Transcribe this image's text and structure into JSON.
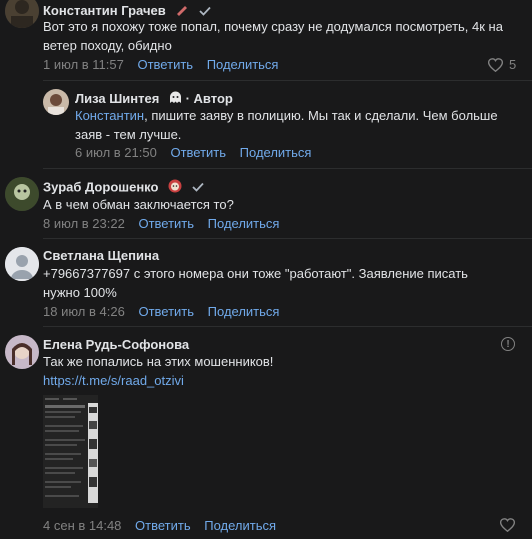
{
  "comments": [
    {
      "author": "Константин Грачев",
      "text": "Вот это я похожу тоже попал, почему сразу не додумался посмотреть, 4к на ветер походу, обидно",
      "date": "1 июл в 11:57",
      "reply_label": "Ответить",
      "share_label": "Поделиться",
      "likes": "5"
    },
    {
      "author": "Лиза Шинтея",
      "author_tag": "· Автор",
      "mention": "Константин",
      "text": ", пишите заяву в полицию. Мы так и сделали. Чем больше заяв - тем лучше.",
      "date": "6 июл в 21:50",
      "reply_label": "Ответить",
      "share_label": "Поделиться"
    },
    {
      "author": "Зураб Дорошенко",
      "text": "А в чем обман заключается то?",
      "date": "8 июл в 23:22",
      "reply_label": "Ответить",
      "share_label": "Поделиться"
    },
    {
      "author": "Светлана Щепина",
      "text": "+79667377697 с этого номера они тоже \"работают\". Заявление писать нужно 100%",
      "date": "18 июл в 4:26",
      "reply_label": "Ответить",
      "share_label": "Поделиться"
    },
    {
      "author": "Елена Рудь-Софонова",
      "text": "Так же попались на этих мошенников!",
      "link": "https://t.me/s/raad_otzivi",
      "date": "4 сен в 14:48",
      "reply_label": "Ответить",
      "share_label": "Поделиться"
    }
  ],
  "icons": {
    "like": "heart-icon",
    "verified": "check-icon",
    "report": "info-icon"
  },
  "colors": {
    "background": "#19191a",
    "link": "#71aaeb",
    "meta": "#828282",
    "text": "#e1e3e6"
  }
}
